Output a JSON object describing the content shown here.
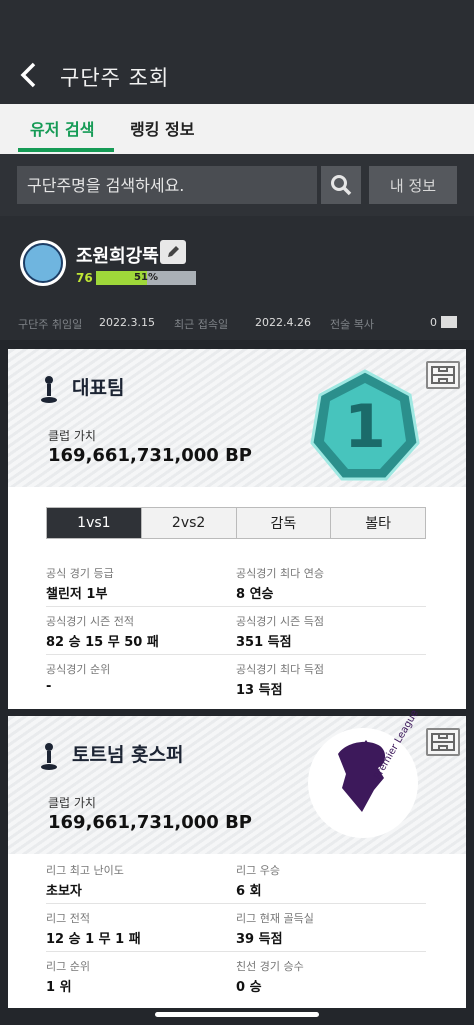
{
  "header": {
    "title": "구단주 조회"
  },
  "tabs": [
    "유저 검색",
    "랭킹 정보"
  ],
  "search": {
    "placeholder": "구단주명을 검색하세요.",
    "my_info": "내 정보"
  },
  "profile": {
    "name": "조원희강뚝",
    "level": "76",
    "xp_percent_label": "51%",
    "xp_fraction": 0.51,
    "since_label": "구단주 취임일",
    "since_value": "2022.3.15",
    "last_label": "최근 접속일",
    "last_value": "2022.4.26",
    "copy_label": "전술 복사",
    "copy_value": "0"
  },
  "cards": [
    {
      "team": "대표팀",
      "club_value_label": "클럽 가치",
      "club_value": "169,661,731,000 BP",
      "badge_number": "1",
      "modes": [
        "1vs1",
        "2vs2",
        "감독",
        "볼타"
      ],
      "stats": [
        {
          "l_label": "공식 경기 등급",
          "l_value": "챌린저 1부",
          "r_label": "공식경기 최다 연승",
          "r_value": "8 연승"
        },
        {
          "l_label": "공식경기 시즌 전적",
          "l_value": "82 승 15 무 50 패",
          "r_label": "공식경기 시즌 득점",
          "r_value": "351 득점"
        },
        {
          "l_label": "공식경기 순위",
          "l_value": "-",
          "r_label": "공식경기 최다 득점",
          "r_value": "13 득점"
        }
      ]
    },
    {
      "team": "토트넘 홋스퍼",
      "club_value_label": "클럽 가치",
      "club_value": "169,661,731,000 BP",
      "pl_text": "Premier League",
      "stats": [
        {
          "l_label": "리그 최고 난이도",
          "l_value": "초보자",
          "r_label": "리그 우승",
          "r_value": "6 회"
        },
        {
          "l_label": "리그 전적",
          "l_value": "12 승 1 무 1 패",
          "r_label": "리그 현재 골득실",
          "r_value": "39 득점"
        },
        {
          "l_label": "리그 순위",
          "l_value": "1 위",
          "r_label": "친선 경기 승수",
          "r_value": "0 승"
        }
      ]
    }
  ],
  "colors": {
    "accent": "#169b56",
    "xp": "#9fd83a",
    "badge": "#3fbdb8"
  }
}
